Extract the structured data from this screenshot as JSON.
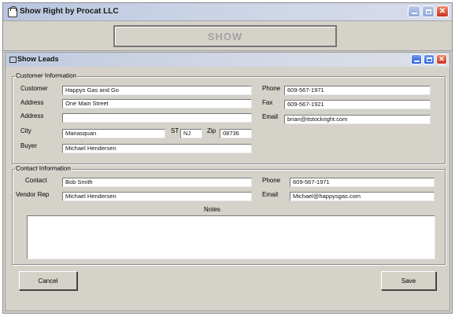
{
  "app": {
    "title": "Show Right by Procat LLC"
  },
  "main_button": {
    "label": "SHOW"
  },
  "child_window": {
    "title": "Show Leads"
  },
  "customer": {
    "section_label": "Customer Information",
    "customer_label": "Customer",
    "customer_value": "Happys Gas and Go",
    "address_label": "Address",
    "address_value": "One Main Street",
    "address2_label": "Address",
    "address2_value": "",
    "city_label": "City",
    "city_value": "Manasquan",
    "st_label": "ST",
    "st_value": "NJ",
    "zip_label": "Zip",
    "zip_value": "08736",
    "buyer_label": "Buyer",
    "buyer_value": "Michael Hendersen",
    "phone_label": "Phone",
    "phone_value": "609-567-1971",
    "fax_label": "Fax",
    "fax_value": "609-567-1921",
    "email_label": "Email",
    "email_value": "brian@itstockright.com"
  },
  "contact": {
    "section_label": "Contact Information",
    "contact_label": "Contact",
    "contact_value": "Bob Smith",
    "vendor_label": "Vendor Rep",
    "vendor_value": "Michael Hendersen",
    "phone_label": "Phone",
    "phone_value": "609-567-1971",
    "email_label": "Email",
    "email_value": "Michael@happysgas.com",
    "notes_label": "Notes",
    "notes_value": ""
  },
  "buttons": {
    "cancel": "Cancel",
    "save": "Save"
  },
  "icons": {
    "app": "app-icon",
    "minimize": "minimize-icon",
    "maximize": "maximize-icon",
    "close": "close-icon"
  },
  "colors": {
    "window_bg": "#d5d2ca",
    "close_red": "#c8321c",
    "title_blue": "#2a5bd6"
  }
}
